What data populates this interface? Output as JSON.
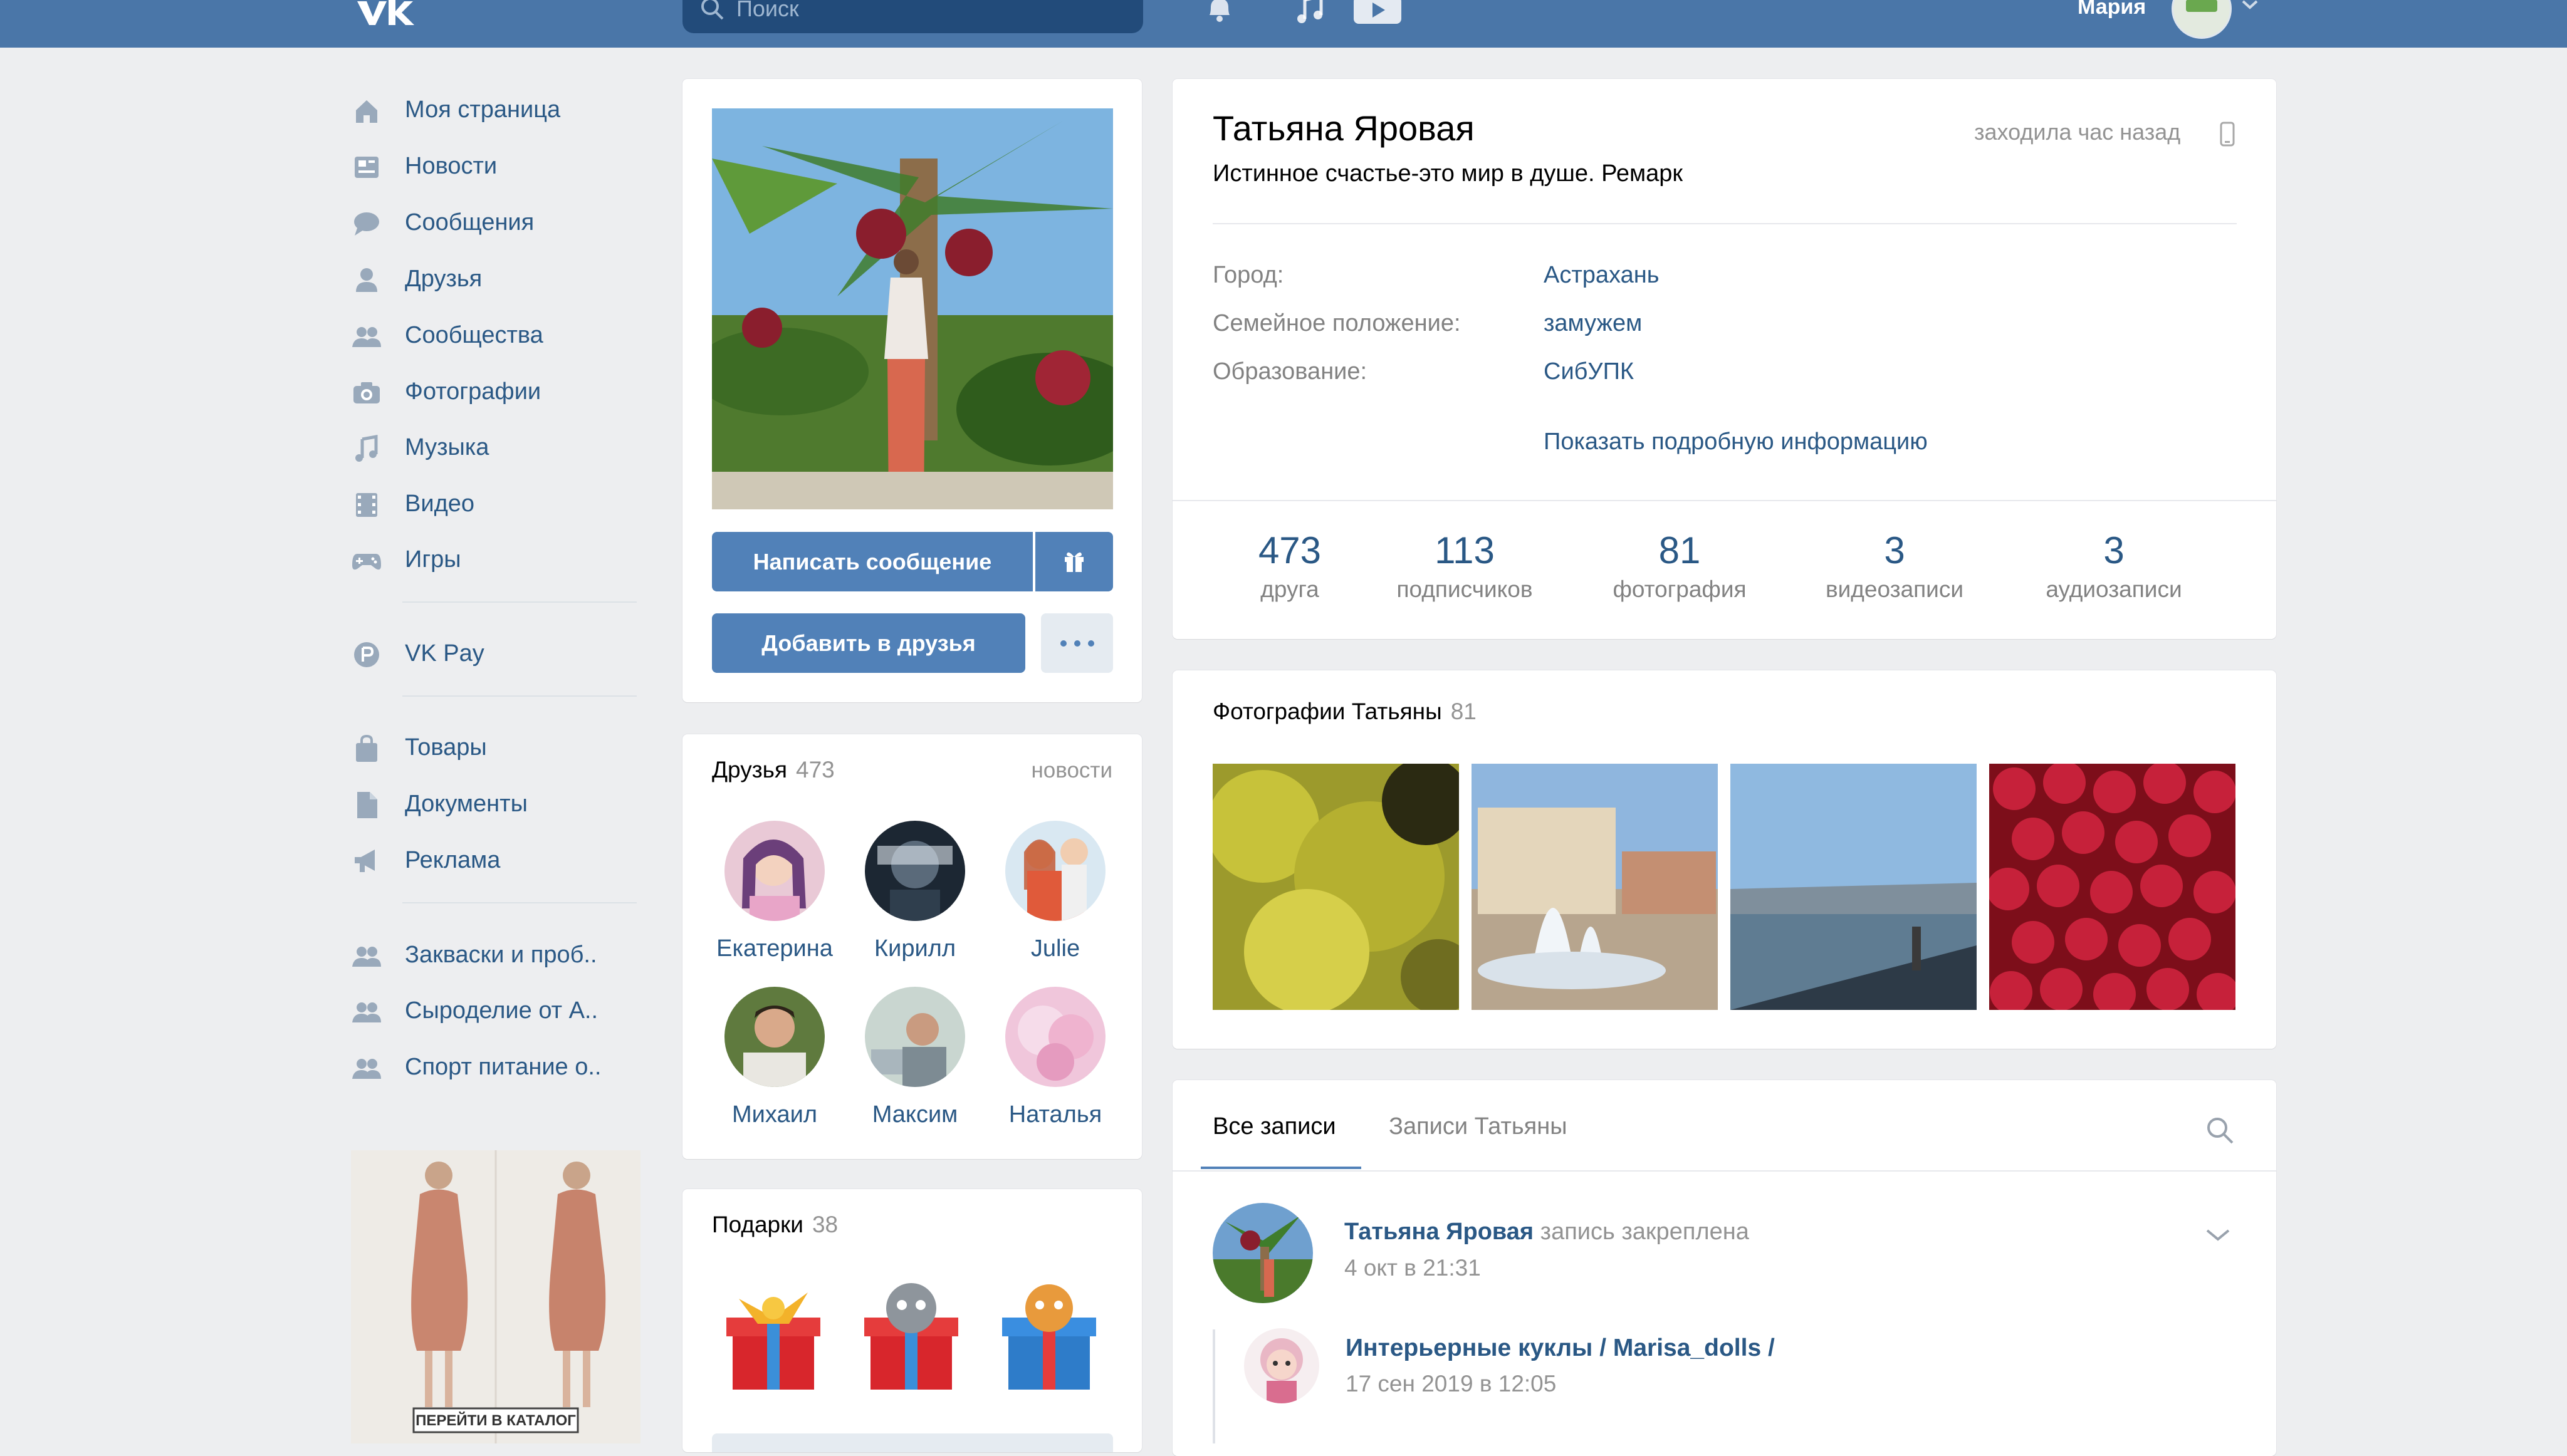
{
  "header": {
    "search_placeholder": "Поиск",
    "user_name": "Мария"
  },
  "nav": [
    {
      "label": "Моя страница",
      "icon": "home-icon"
    },
    {
      "label": "Новости",
      "icon": "news-icon"
    },
    {
      "label": "Сообщения",
      "icon": "messages-icon"
    },
    {
      "label": "Друзья",
      "icon": "friends-icon"
    },
    {
      "label": "Сообщества",
      "icon": "communities-icon"
    },
    {
      "label": "Фотографии",
      "icon": "camera-icon"
    },
    {
      "label": "Музыка",
      "icon": "music-icon"
    },
    {
      "label": "Видео",
      "icon": "video-icon"
    },
    {
      "label": "Игры",
      "icon": "gamepad-icon"
    },
    {
      "label": "VK Pay",
      "icon": "vkpay-icon"
    },
    {
      "label": "Товары",
      "icon": "bag-icon"
    },
    {
      "label": "Документы",
      "icon": "document-icon"
    },
    {
      "label": "Реклама",
      "icon": "megaphone-icon"
    },
    {
      "label": "Закваски и проб..",
      "icon": "group-icon"
    },
    {
      "label": "Сыроделие от А..",
      "icon": "group-icon"
    },
    {
      "label": "Спорт питание о..",
      "icon": "group-icon"
    }
  ],
  "ad": {
    "caption": "ПЕРЕЙТИ В КАТАЛОГ"
  },
  "profile_actions": {
    "write_message": "Написать сообщение",
    "add_friend": "Добавить в друзья"
  },
  "friends": {
    "title": "Друзья",
    "count": "473",
    "news_link": "новости",
    "items": [
      "Екатерина",
      "Кирилл",
      "Julie",
      "Михаил",
      "Максим",
      "Наталья"
    ]
  },
  "gifts": {
    "title": "Подарки",
    "count": "38"
  },
  "profile": {
    "name": "Татьяна Яровая",
    "status": "Истинное счастье-это мир в душе. Ремарк",
    "last_seen": "заходила час назад",
    "info": [
      {
        "label": "Город:",
        "value": "Астрахань"
      },
      {
        "label": "Семейное положение:",
        "value": "замужем"
      },
      {
        "label": "Образование:",
        "value": "СибУПК"
      }
    ],
    "show_more": "Показать подробную информацию"
  },
  "counters": [
    {
      "number": "473",
      "label": "друга"
    },
    {
      "number": "113",
      "label": "подписчиков"
    },
    {
      "number": "81",
      "label": "фотография"
    },
    {
      "number": "3",
      "label": "видеозаписи"
    },
    {
      "number": "3",
      "label": "аудиозаписи"
    }
  ],
  "photos_section": {
    "title": "Фотографии Татьяны",
    "count": "81"
  },
  "wall": {
    "tab_all": "Все записи",
    "tab_own": "Записи Татьяны",
    "post": {
      "author": "Татьяна Яровая",
      "pinned_text": "запись закреплена",
      "date": "4 окт в 21:31",
      "repost_source": "Интерьерные куклы / Marisa_dolls /",
      "repost_date": "17 сен 2019 в 12:05"
    }
  },
  "colors": {
    "header": "#4a76a8",
    "link": "#2a5885",
    "button_blue": "#5181b8",
    "background": "#edeef0"
  }
}
